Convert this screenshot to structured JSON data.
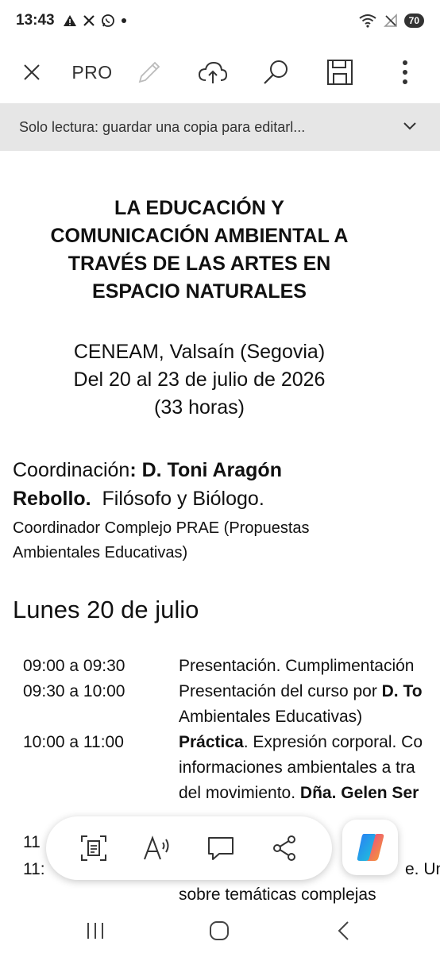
{
  "status_bar": {
    "time": "13:43",
    "notification_icons": [
      "warning-icon",
      "x-icon",
      "whatsapp-icon",
      "dot-icon"
    ],
    "battery_level": "70"
  },
  "toolbar": {
    "pro_label": "PRO"
  },
  "readonly_bar": {
    "text": "Solo lectura: guardar una copia para editarl..."
  },
  "document": {
    "title_lines": [
      "LA EDUCACIÓN Y",
      "COMUNICACIÓN AMBIENTAL A",
      "TRAVÉS DE LAS ARTES EN",
      "ESPACIO NATURALES"
    ],
    "location": "CENEAM, Valsaín (Segovia)",
    "dates": "Del 20 al 23 de julio de 2026",
    "hours": "(33 horas)",
    "coordination": {
      "label": "Coordinación",
      "colon": ":",
      "name_line1": " D. Toni Aragón",
      "name_line2": "Rebollo.",
      "role": "  Filósofo y Biólogo.",
      "sub_line1": "Coordinador Complejo PRAE (Propuestas",
      "sub_line2": "Ambientales Educativas)"
    },
    "day_heading": "Lunes 20 de julio",
    "schedule": [
      {
        "time": "09:00 a 09:30",
        "lines": [
          {
            "plain": "Presentación. Cumplimentación",
            "bold": ""
          }
        ]
      },
      {
        "time": "09:30 a 10:00",
        "lines": [
          {
            "plain": "Presentación del curso por ",
            "bold": "D. To"
          },
          {
            "plain": "Ambientales Educativas)",
            "bold": ""
          }
        ]
      },
      {
        "time": "10:00 a 11:00",
        "lines": [
          {
            "bold_first": "Práctica",
            "plain": ". Expresión corporal. Co"
          },
          {
            "plain": "informaciones ambientales a tra",
            "bold": ""
          },
          {
            "plain": "del movimiento. ",
            "bold": "Dña. Gelen Ser"
          }
        ]
      },
      {
        "time": "11",
        "lines": []
      },
      {
        "time": "11:",
        "lines": [
          {
            "plain": "e. Una",
            "bold": ""
          },
          {
            "plain": "sobre temáticas complejas",
            "bold": ""
          }
        ]
      }
    ]
  },
  "action_bar": {
    "buttons": [
      "text-extract-icon",
      "read-aloud-icon",
      "comment-icon",
      "share-icon"
    ],
    "copilot": "copilot-icon"
  },
  "nav_bar": {
    "buttons": [
      "recents-icon",
      "home-icon",
      "back-icon"
    ]
  }
}
